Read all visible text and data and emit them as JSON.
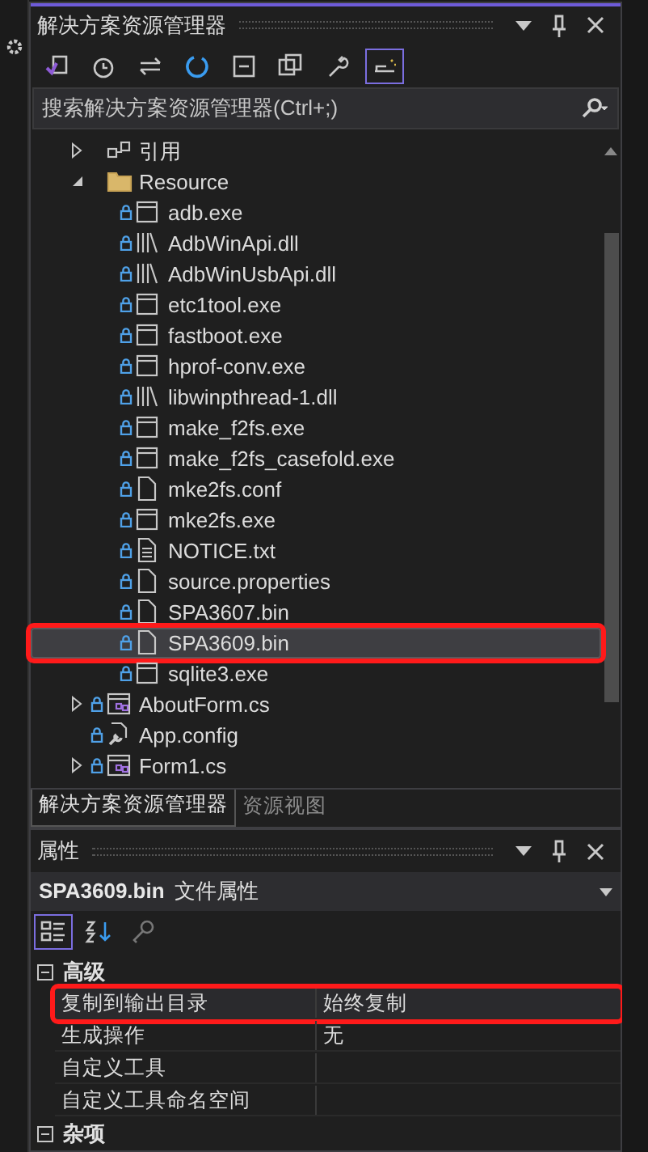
{
  "explorer": {
    "title": "解决方案资源管理器",
    "toolbar": [
      {
        "kind": "home",
        "selected": false
      },
      {
        "kind": "history",
        "selected": false
      },
      {
        "kind": "sync",
        "selected": false
      },
      {
        "kind": "refresh",
        "selected": false
      },
      {
        "kind": "collapse",
        "selected": false
      },
      {
        "kind": "show-all",
        "selected": false
      },
      {
        "kind": "properties",
        "selected": false
      },
      {
        "kind": "preview",
        "selected": true
      }
    ],
    "search": {
      "placeholder": "搜索解决方案资源管理器(Ctrl+;)"
    },
    "tree": [
      {
        "label": "引用",
        "kind": "references",
        "locked": false,
        "expanded": false,
        "selected": false,
        "annotated": false
      },
      {
        "label": "Resource",
        "kind": "folder",
        "locked": false,
        "expanded": true,
        "selected": false,
        "annotated": false,
        "children": [
          {
            "label": "adb.exe",
            "kind": "exe",
            "locked": true,
            "selected": false,
            "annotated": false
          },
          {
            "label": "AdbWinApi.dll",
            "kind": "dll",
            "locked": true,
            "selected": false,
            "annotated": false
          },
          {
            "label": "AdbWinUsbApi.dll",
            "kind": "dll",
            "locked": true,
            "selected": false,
            "annotated": false
          },
          {
            "label": "etc1tool.exe",
            "kind": "exe",
            "locked": true,
            "selected": false,
            "annotated": false
          },
          {
            "label": "fastboot.exe",
            "kind": "exe",
            "locked": true,
            "selected": false,
            "annotated": false
          },
          {
            "label": "hprof-conv.exe",
            "kind": "exe",
            "locked": true,
            "selected": false,
            "annotated": false
          },
          {
            "label": "libwinpthread-1.dll",
            "kind": "dll",
            "locked": true,
            "selected": false,
            "annotated": false
          },
          {
            "label": "make_f2fs.exe",
            "kind": "exe",
            "locked": true,
            "selected": false,
            "annotated": false
          },
          {
            "label": "make_f2fs_casefold.exe",
            "kind": "exe",
            "locked": true,
            "selected": false,
            "annotated": false
          },
          {
            "label": "mke2fs.conf",
            "kind": "file",
            "locked": true,
            "selected": false,
            "annotated": false
          },
          {
            "label": "mke2fs.exe",
            "kind": "exe",
            "locked": true,
            "selected": false,
            "annotated": false
          },
          {
            "label": "NOTICE.txt",
            "kind": "text",
            "locked": true,
            "selected": false,
            "annotated": false
          },
          {
            "label": "source.properties",
            "kind": "file",
            "locked": true,
            "selected": false,
            "annotated": false
          },
          {
            "label": "SPA3607.bin",
            "kind": "file",
            "locked": true,
            "selected": false,
            "annotated": false
          },
          {
            "label": "SPA3609.bin",
            "kind": "file",
            "locked": true,
            "selected": true,
            "annotated": true
          },
          {
            "label": "sqlite3.exe",
            "kind": "exe",
            "locked": true,
            "selected": false,
            "annotated": false
          }
        ]
      },
      {
        "label": "AboutForm.cs",
        "kind": "form",
        "locked": true,
        "expanded": false,
        "selected": false,
        "annotated": false
      },
      {
        "label": "App.config",
        "kind": "config",
        "locked": true,
        "selected": false,
        "annotated": false
      },
      {
        "label": "Form1.cs",
        "kind": "form",
        "locked": true,
        "expanded": false,
        "selected": false,
        "annotated": false
      }
    ],
    "tabs": [
      {
        "label": "解决方案资源管理器",
        "selected": true
      },
      {
        "label": "资源视图",
        "selected": false
      }
    ]
  },
  "properties": {
    "title": "属性",
    "subject": "SPA3609.bin",
    "subject_type": "文件属性",
    "toolbar": [
      {
        "kind": "categorized",
        "selected": true
      },
      {
        "kind": "alphabetical",
        "selected": false
      },
      {
        "kind": "property-pages",
        "selected": false
      }
    ],
    "categories": [
      {
        "label": "高级",
        "expanded": true,
        "rows": [
          {
            "name": "复制到输出目录",
            "value": "始终复制",
            "annotated": true
          },
          {
            "name": "生成操作",
            "value": "无",
            "annotated": false
          },
          {
            "name": "自定义工具",
            "annotated": false
          },
          {
            "name": "自定义工具命名空间",
            "annotated": false
          }
        ]
      },
      {
        "label": "杂项",
        "expanded": true
      }
    ]
  }
}
